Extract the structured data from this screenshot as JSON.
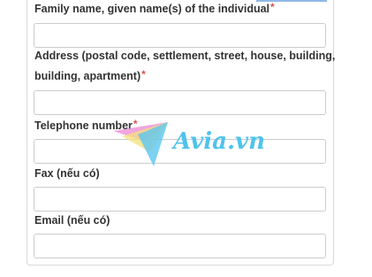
{
  "form": {
    "family_name": {
      "label": "Family name, given name(s) of the individual",
      "required_mark": "*",
      "value": ""
    },
    "address": {
      "label_line1": "Address (postal code, settlement, street, house, building,",
      "label_line2": "building, apartment)",
      "required_mark": "*",
      "value": ""
    },
    "telephone": {
      "label": "Telephone number",
      "required_mark": "*",
      "value": ""
    },
    "fax": {
      "label": "Fax (nếu có)",
      "value": ""
    },
    "email": {
      "label": "Email (nếu có)",
      "value": ""
    }
  },
  "watermark": {
    "text": "Avia.vn",
    "colors": {
      "text": "#4fc3ec",
      "plane_pink": "#e98ad1",
      "plane_yellow": "#f4e27a",
      "plane_blue": "#5cc6f0"
    }
  },
  "colors": {
    "required": "#d9534f",
    "label": "#333333",
    "border": "#cccccc"
  }
}
